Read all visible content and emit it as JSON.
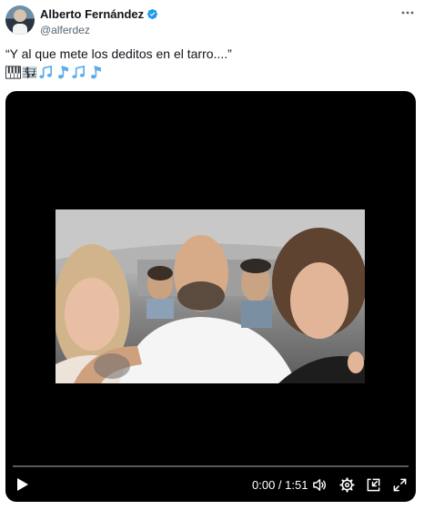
{
  "author": {
    "display_name": "Alberto Fernández",
    "handle": "@alferdez",
    "verified": true,
    "verified_color": "#1d9bf0"
  },
  "tweet": {
    "text": "“Y al que mete los deditos en el tarro....”",
    "emojis": [
      "piano-emoji",
      "musical-score-emoji",
      "musical-notes-emoji",
      "musical-note-emoji",
      "musical-notes-emoji",
      "musical-note-emoji"
    ]
  },
  "video": {
    "current_time": "0:00",
    "duration": "1:51",
    "time_display": "0:00 / 1:51",
    "progress": 0
  },
  "icons": {
    "more": "more-horizontal-icon",
    "play": "play-icon",
    "volume": "volume-icon",
    "settings": "settings-icon",
    "pip": "picture-in-picture-icon",
    "fullscreen": "fullscreen-icon"
  }
}
